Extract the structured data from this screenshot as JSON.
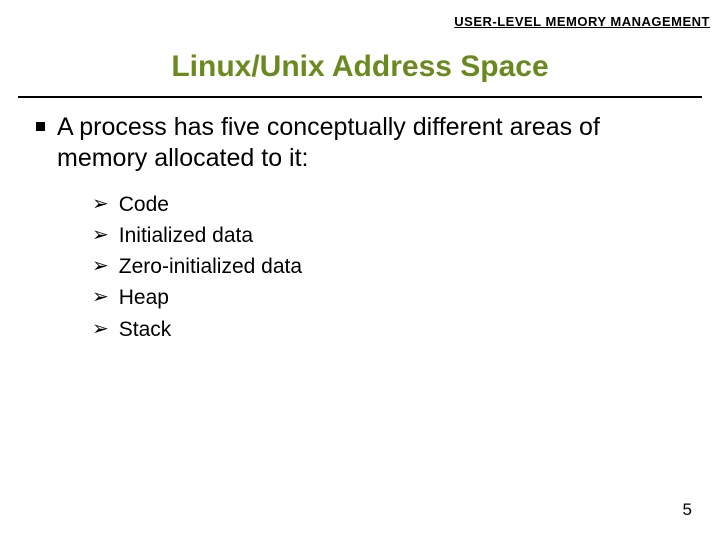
{
  "header": {
    "section_label": "USER-LEVEL MEMORY MANAGEMENT"
  },
  "title": "Linux/Unix Address Space",
  "main": {
    "bullet": "A process has five conceptually different areas of memory allocated to it:",
    "items": [
      "Code",
      "Initialized data",
      "Zero-initialized data",
      "Heap",
      "Stack"
    ]
  },
  "page_number": "5",
  "glyphs": {
    "arrow": "➢"
  }
}
